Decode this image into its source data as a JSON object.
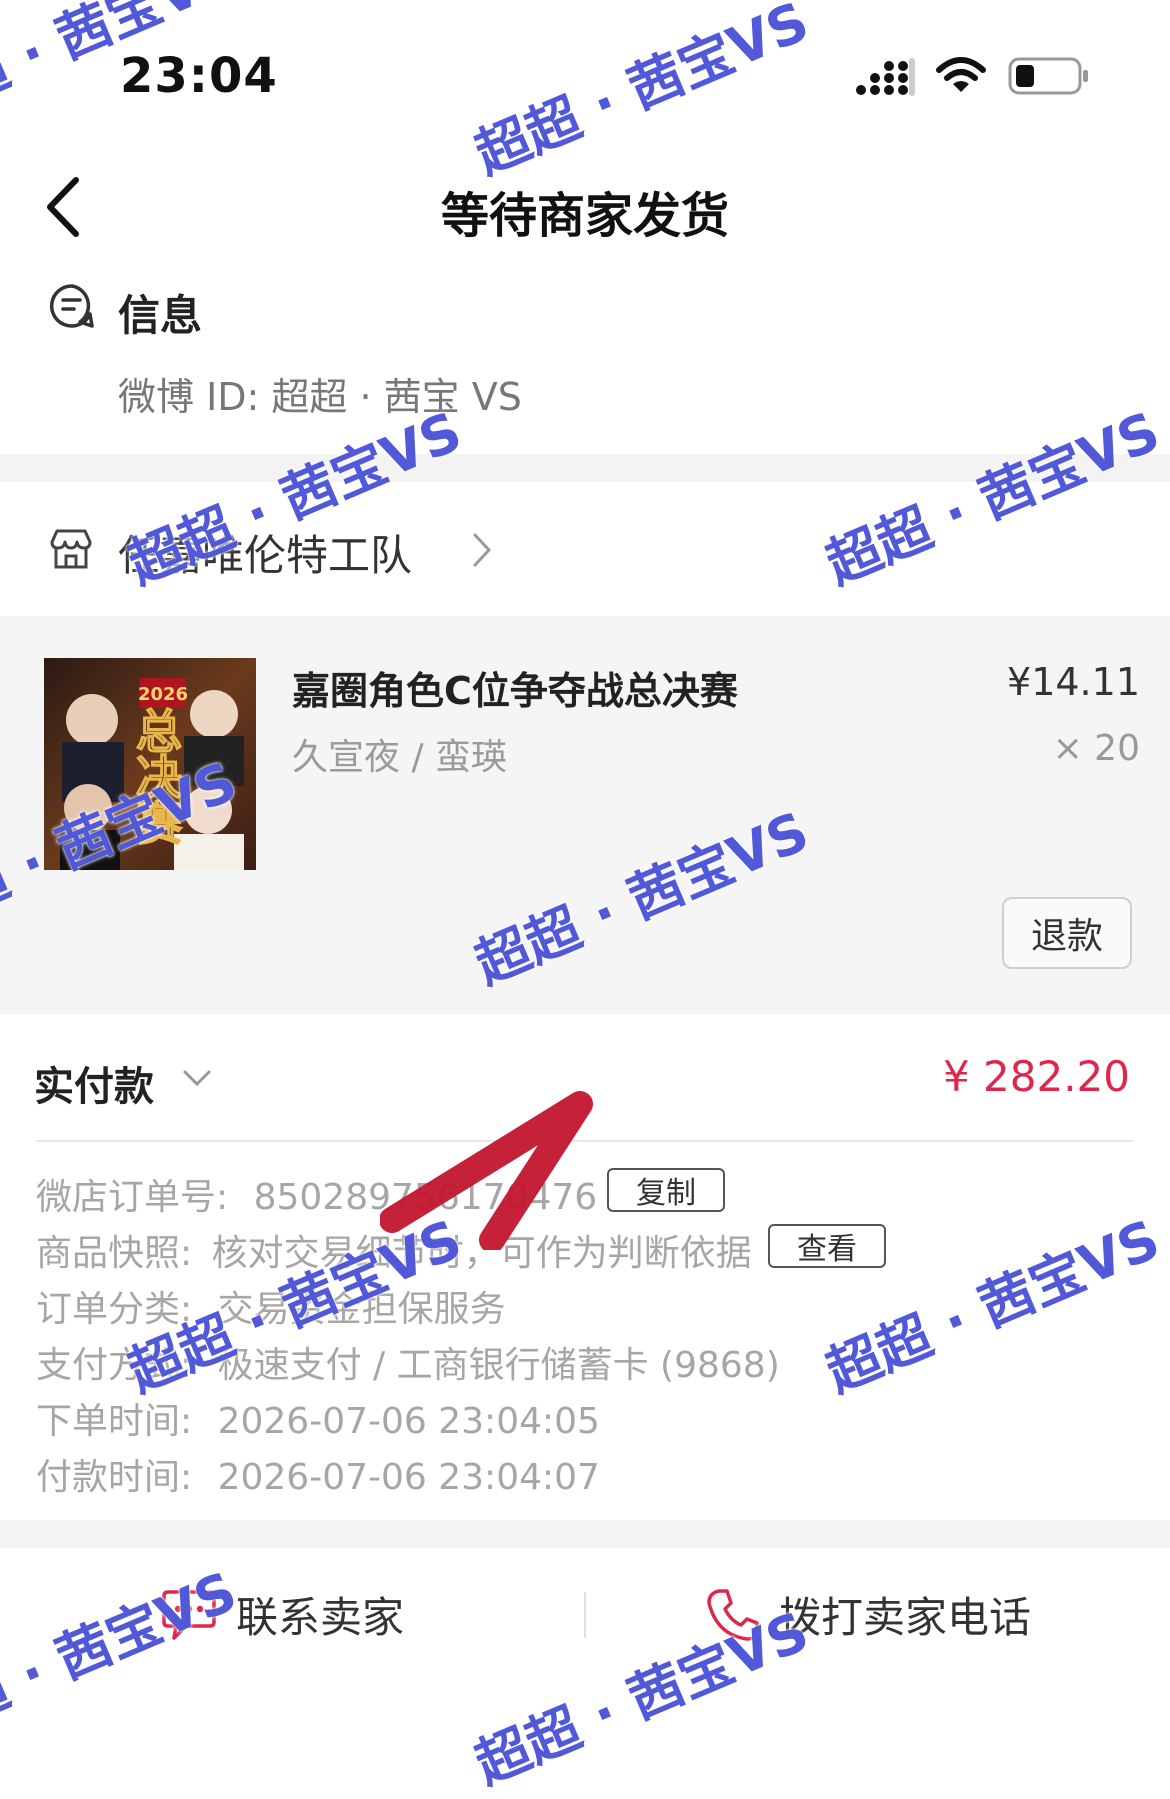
{
  "status_bar": {
    "time": "23:04"
  },
  "nav": {
    "title": "等待商家发货"
  },
  "info": {
    "title": "信息",
    "weibo_id": "微博 ID: 超超 · 茜宝 VS"
  },
  "shop": {
    "name": "任嘉唯伦特工队"
  },
  "product": {
    "title": "嘉圈角色C位争夺战总决赛",
    "spec": "久宣夜 / 蛮瑛",
    "price": "¥14.11",
    "qty": "× 20",
    "thumb_text": "总决赛",
    "thumb_year": "2026",
    "refund_label": "退款"
  },
  "payment": {
    "label": "实付款",
    "amount": "¥ 282.20"
  },
  "order": {
    "order_no_key": "微店订单号:",
    "order_no_val": "850289756170476",
    "copy_label": "复制",
    "snapshot_key": "商品快照:",
    "snapshot_val": "核对交易细节时，可作为判断依据",
    "view_label": "查看",
    "category_key": "订单分类:",
    "category_val": "交易资金担保服务",
    "pay_method_key": "支付方式:",
    "pay_method_val": "极速支付 / 工商银行储蓄卡 (9868)",
    "order_time_key": "下单时间:",
    "order_time_val": "2026-07-06 23:04:05",
    "pay_time_key": "付款时间:",
    "pay_time_val": "2026-07-06 23:04:07"
  },
  "bottom": {
    "contact_label": "联系卖家",
    "call_label": "拨打卖家电话"
  },
  "watermark": {
    "text": "超超 · 茜宝VS"
  },
  "colors": {
    "price_red": "#e0264a",
    "watermark_blue": "#323cd2",
    "icon_red": "#e0264a"
  }
}
